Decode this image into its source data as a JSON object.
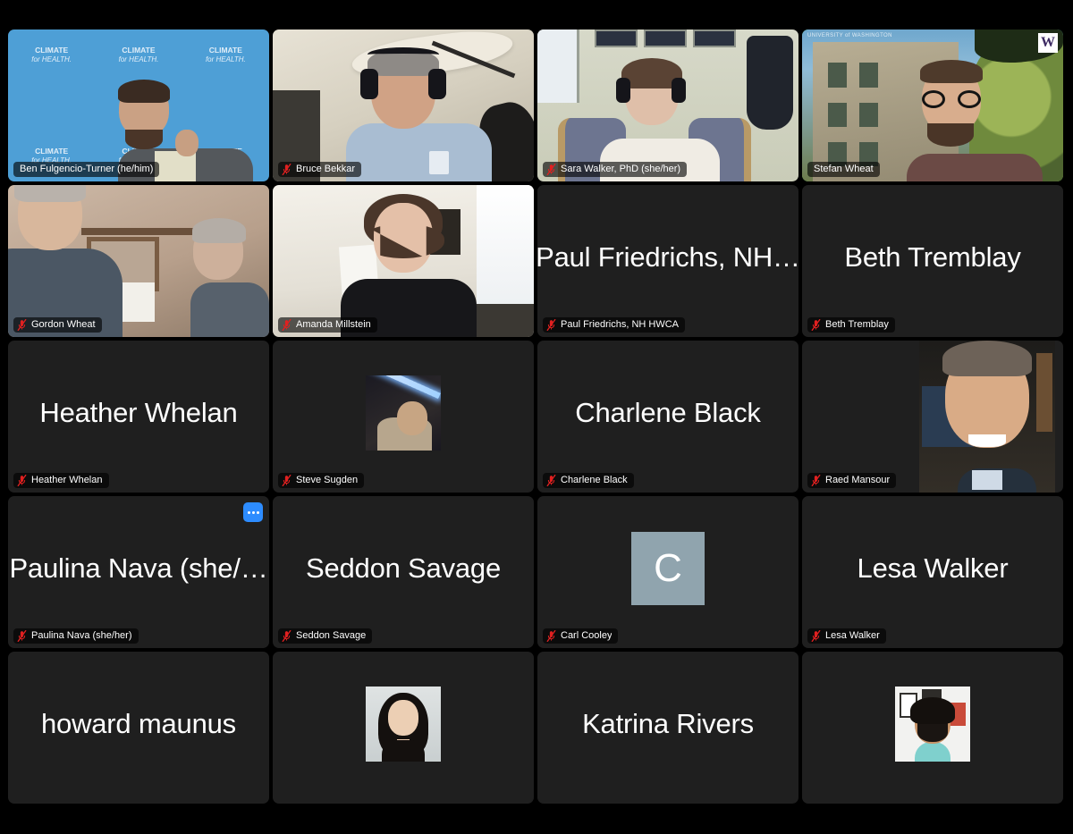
{
  "app": {
    "name": "Zoom",
    "view": "gallery-view",
    "background_color": "#000000"
  },
  "theme": {
    "tile_background": "#1f1f1f",
    "active_speaker_border": "#25c33e",
    "more_button_color": "#2d8cff",
    "mute_icon_color": "#e02020",
    "name_text_color": "#ffffff",
    "avatar_initial_background": "#90a4ae"
  },
  "grid": {
    "columns": 4,
    "rows": 5,
    "visible_participants": 20
  },
  "participants": [
    {
      "id": "ben-fulgencio-turner",
      "display_name": "Ben Fulgencio-Turner (he/him)",
      "badge_label": "Ben Fulgencio-Turner (he/him)",
      "video_on": true,
      "muted": false,
      "active_speaker": false,
      "background_text": {
        "line1": "CLIMATE",
        "line2": "for HEALTH."
      }
    },
    {
      "id": "bruce-bekkar",
      "display_name": "Bruce Bekkar",
      "badge_label": "Bruce Bekkar",
      "video_on": true,
      "muted": true,
      "active_speaker": false
    },
    {
      "id": "sara-walker",
      "display_name": "Sara Walker, PhD (she/her)",
      "badge_label": "Sara Walker, PhD (she/her)",
      "video_on": true,
      "muted": true,
      "active_speaker": false
    },
    {
      "id": "stefan-wheat",
      "display_name": "Stefan Wheat",
      "badge_label": "Stefan Wheat",
      "video_on": true,
      "muted": false,
      "active_speaker": true,
      "background_watermark": "W",
      "background_caption": "UNIVERSITY of WASHINGTON"
    },
    {
      "id": "gordon-wheat",
      "display_name": "Gordon Wheat",
      "badge_label": "Gordon Wheat",
      "video_on": true,
      "muted": true,
      "active_speaker": false
    },
    {
      "id": "amanda-millstein",
      "display_name": "Amanda Millstein",
      "badge_label": "Amanda Millstein",
      "video_on": true,
      "muted": true,
      "active_speaker": false
    },
    {
      "id": "paul-friedrichs",
      "display_name": "Paul Friedrichs, NH…",
      "badge_label": "Paul Friedrichs, NH HWCA",
      "video_on": false,
      "muted": true,
      "active_speaker": false
    },
    {
      "id": "beth-tremblay",
      "display_name": "Beth Tremblay",
      "badge_label": "Beth Tremblay",
      "video_on": false,
      "muted": true,
      "active_speaker": false
    },
    {
      "id": "heather-whelan",
      "display_name": "Heather Whelan",
      "badge_label": "Heather Whelan",
      "video_on": false,
      "muted": true,
      "active_speaker": false
    },
    {
      "id": "steve-sugden",
      "display_name": "Steve Sugden",
      "badge_label": "Steve Sugden",
      "video_on": false,
      "muted": true,
      "active_speaker": false,
      "avatar_type": "photo-small"
    },
    {
      "id": "charlene-black",
      "display_name": "Charlene Black",
      "badge_label": "Charlene Black",
      "video_on": false,
      "muted": true,
      "active_speaker": false
    },
    {
      "id": "raed-mansour",
      "display_name": "Raed Mansour",
      "badge_label": "Raed Mansour",
      "video_on": false,
      "muted": true,
      "active_speaker": false,
      "avatar_type": "photo-large"
    },
    {
      "id": "paulina-nava",
      "display_name": "Paulina Nava (she/…",
      "badge_label": "Paulina Nava (she/her)",
      "video_on": false,
      "muted": true,
      "active_speaker": false,
      "more_menu_visible": true
    },
    {
      "id": "seddon-savage",
      "display_name": "Seddon Savage",
      "badge_label": "Seddon Savage",
      "video_on": false,
      "muted": true,
      "active_speaker": false
    },
    {
      "id": "carl-cooley",
      "display_name": "Carl Cooley",
      "badge_label": "Carl Cooley",
      "video_on": false,
      "muted": true,
      "active_speaker": false,
      "avatar_type": "initial",
      "avatar_initial": "C"
    },
    {
      "id": "lesa-walker",
      "display_name": "Lesa Walker",
      "badge_label": "Lesa Walker",
      "video_on": false,
      "muted": true,
      "active_speaker": false
    },
    {
      "id": "howard-maunus",
      "display_name": "howard maunus",
      "badge_label": "",
      "video_on": false,
      "muted": true,
      "active_speaker": false
    },
    {
      "id": "participant-row5-col2",
      "display_name": "",
      "badge_label": "",
      "video_on": false,
      "muted": true,
      "active_speaker": false,
      "avatar_type": "photo-small"
    },
    {
      "id": "katrina-rivers",
      "display_name": "Katrina Rivers",
      "badge_label": "",
      "video_on": false,
      "muted": true,
      "active_speaker": false
    },
    {
      "id": "participant-row5-col4",
      "display_name": "",
      "badge_label": "",
      "video_on": false,
      "muted": true,
      "active_speaker": false,
      "avatar_type": "photo-small"
    }
  ]
}
